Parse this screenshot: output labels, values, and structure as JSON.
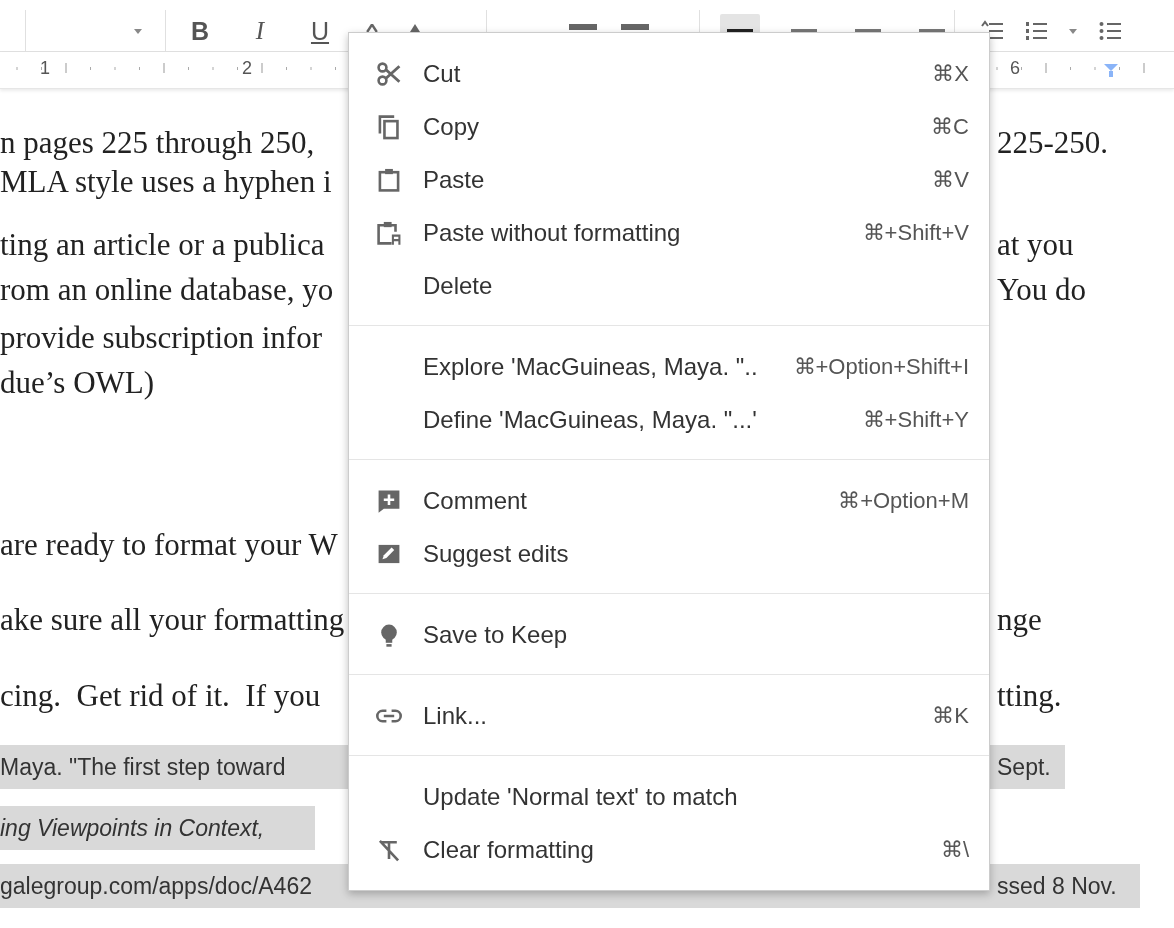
{
  "toolbar": {
    "format_buttons": [
      {
        "label": "B",
        "kind": "bold"
      },
      {
        "label": "I",
        "kind": "italic"
      },
      {
        "label": "U",
        "kind": "underline"
      }
    ],
    "align_buttons": [
      {
        "selected": true
      },
      {
        "selected": false
      },
      {
        "selected": false
      },
      {
        "selected": false
      }
    ]
  },
  "ruler": {
    "numbers": [
      "1",
      "2",
      "6"
    ]
  },
  "document": {
    "lines": [
      {
        "left": "n pages 225 through 250,",
        "right": "225-250.",
        "kind": "body",
        "highlighted": false,
        "italic": false
      },
      {
        "left": "MLA style uses a hyphen i",
        "kind": "body",
        "highlighted": false,
        "italic": false
      },
      {
        "left": "ting an article or a publica",
        "right": "at you",
        "kind": "body",
        "highlighted": false,
        "italic": false
      },
      {
        "left": "rom an online database, yo",
        "right": "You do",
        "kind": "body",
        "highlighted": false,
        "italic": false
      },
      {
        "left": "provide subscription infor",
        "kind": "body",
        "highlighted": false,
        "italic": false
      },
      {
        "left": "due’s OWL)",
        "kind": "body",
        "highlighted": false,
        "italic": false
      },
      {
        "left": "are ready to format your W",
        "kind": "body",
        "highlighted": false,
        "italic": false
      },
      {
        "left": "ake sure all your formatting",
        "right": "nge",
        "kind": "body",
        "highlighted": false,
        "italic": false
      },
      {
        "left": "cing.  Get rid of it.  If you",
        "right": "tting.",
        "kind": "body",
        "highlighted": false,
        "italic": false
      },
      {
        "left": "Maya. \"The first step toward",
        "right": "Sept.",
        "kind": "citation",
        "highlighted": true,
        "italic": false
      },
      {
        "left": "ing Viewpoints in Context,",
        "kind": "citation",
        "highlighted": true,
        "italic": true
      },
      {
        "left": "galegroup.com/apps/doc/A462",
        "right": "ssed 8 Nov.",
        "kind": "citation",
        "highlighted": true,
        "italic": false
      }
    ]
  },
  "context_menu": {
    "sections": [
      [
        {
          "label": "Cut",
          "shortcut": "⌘X",
          "kind": "scissors"
        },
        {
          "label": "Copy",
          "shortcut": "⌘C",
          "kind": "copy"
        },
        {
          "label": "Paste",
          "shortcut": "⌘V",
          "kind": "clipboard"
        },
        {
          "label": "Paste without formatting",
          "shortcut": "⌘+Shift+V",
          "kind": "plainclipboard"
        },
        {
          "label": "Delete",
          "kind": "none"
        }
      ],
      [
        {
          "label": "Explore 'MacGuineas, Maya. \"..",
          "shortcut": "⌘+Option+Shift+I",
          "kind": "none"
        },
        {
          "label": "Define 'MacGuineas, Maya. \"...'",
          "shortcut": "⌘+Shift+Y",
          "kind": "none"
        }
      ],
      [
        {
          "label": "Comment",
          "shortcut": "⌘+Option+M",
          "kind": "comment"
        },
        {
          "label": "Suggest edits",
          "kind": "suggest"
        }
      ],
      [
        {
          "label": "Save to Keep",
          "kind": "bulb"
        }
      ],
      [
        {
          "label": "Link...",
          "shortcut": "⌘K",
          "kind": "link"
        }
      ],
      [
        {
          "label": "Update 'Normal text' to match",
          "kind": "none"
        },
        {
          "label": "Clear formatting",
          "shortcut": "⌘\\",
          "kind": "clear"
        }
      ]
    ]
  }
}
